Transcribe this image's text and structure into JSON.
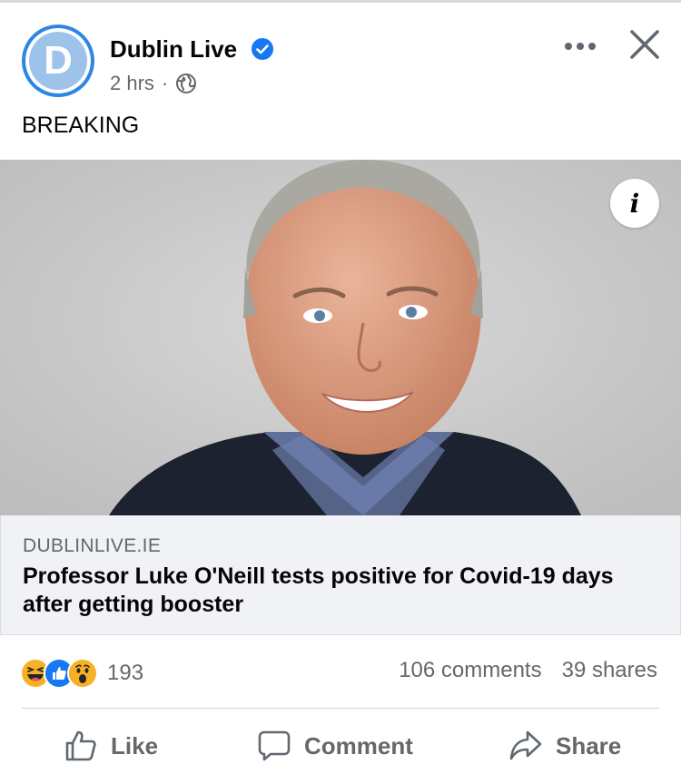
{
  "post": {
    "page_name": "Dublin Live",
    "avatar_letter": "D",
    "time": "2 hrs",
    "separator": "·",
    "text": "BREAKING"
  },
  "link_preview": {
    "domain": "DUBLINLIVE.IE",
    "headline": "Professor Luke O'Neill tests positive for Covid-19 days after getting booster"
  },
  "reactions": {
    "icons": [
      "laugh-reaction-icon",
      "like-reaction-icon",
      "wow-reaction-icon"
    ],
    "count": "193",
    "comments": "106 comments",
    "shares": "39 shares"
  },
  "actions": {
    "like_label": "Like",
    "comment_label": "Comment",
    "share_label": "Share"
  },
  "colors": {
    "brand_blue": "#1877f2",
    "secondary_text": "#65676b",
    "link_card_bg": "#f0f2f5",
    "wow_yellow": "#f7b125"
  }
}
